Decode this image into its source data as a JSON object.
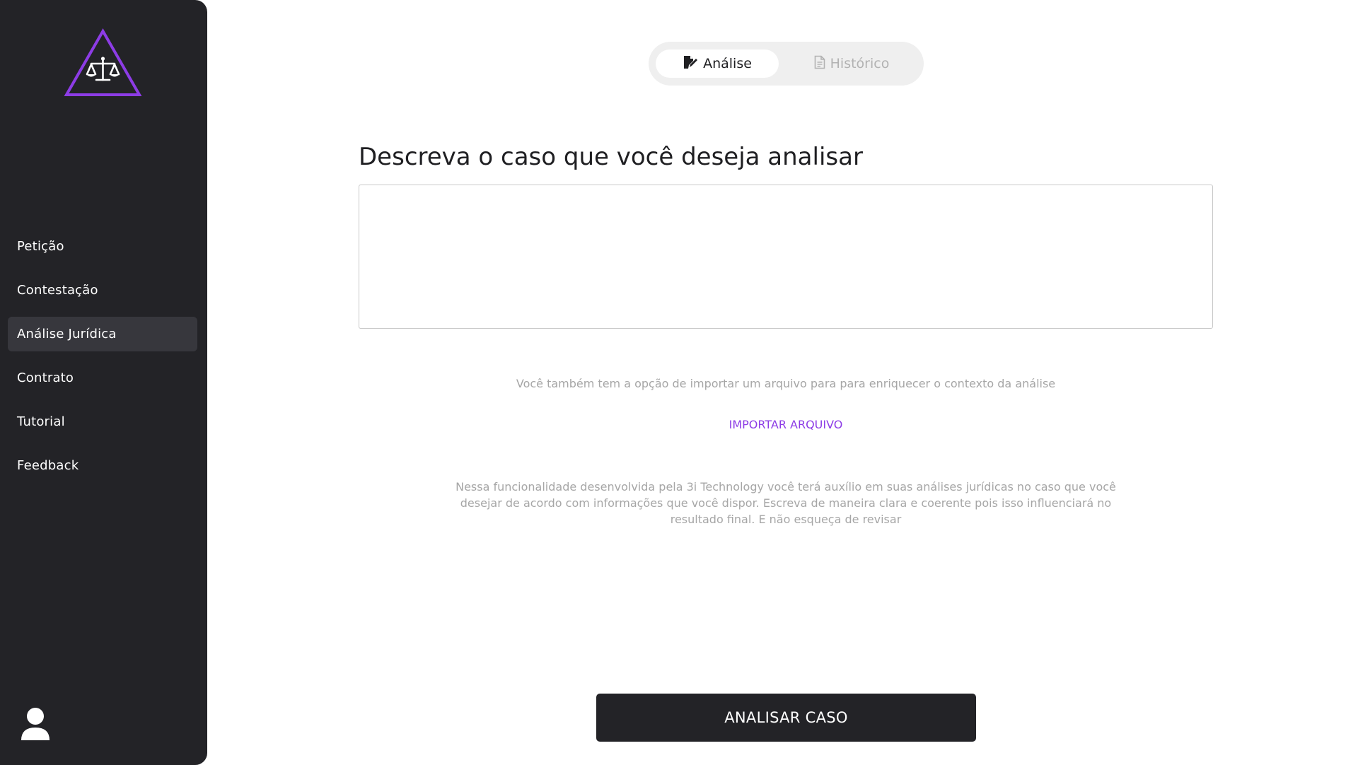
{
  "sidebar": {
    "logo_icon": "scales-of-justice-triangle-logo",
    "accent_color": "#8d3ce6",
    "items": [
      {
        "label": "Petição",
        "active": false
      },
      {
        "label": "Contestação",
        "active": false
      },
      {
        "label": "Análise Jurídica",
        "active": true
      },
      {
        "label": "Contrato",
        "active": false
      },
      {
        "label": "Tutorial",
        "active": false
      },
      {
        "label": "Feedback",
        "active": false
      }
    ],
    "user_icon": "user-icon"
  },
  "tabs": {
    "analysis": {
      "label": "Análise",
      "icon": "edit-document-icon",
      "active": true
    },
    "history": {
      "label": "Histórico",
      "icon": "file-icon",
      "active": false
    }
  },
  "main": {
    "heading": "Descreva o caso que você deseja analisar",
    "case_input": {
      "value": "",
      "placeholder": ""
    },
    "import_hint": "Você também tem a opção de importar um arquivo para para enriquecer o contexto da análise",
    "import_link": "IMPORTAR ARQUIVO",
    "description": "Nessa funcionalidade desenvolvida pela 3i Technology você terá auxílio em suas análises jurídicas no caso que você desejar de acordo com informações que você dispor. Escreva de maneira clara e coerente pois isso influenciará no resultado final. E não esqueça de revisar",
    "analyze_button": "ANALISAR CASO"
  }
}
